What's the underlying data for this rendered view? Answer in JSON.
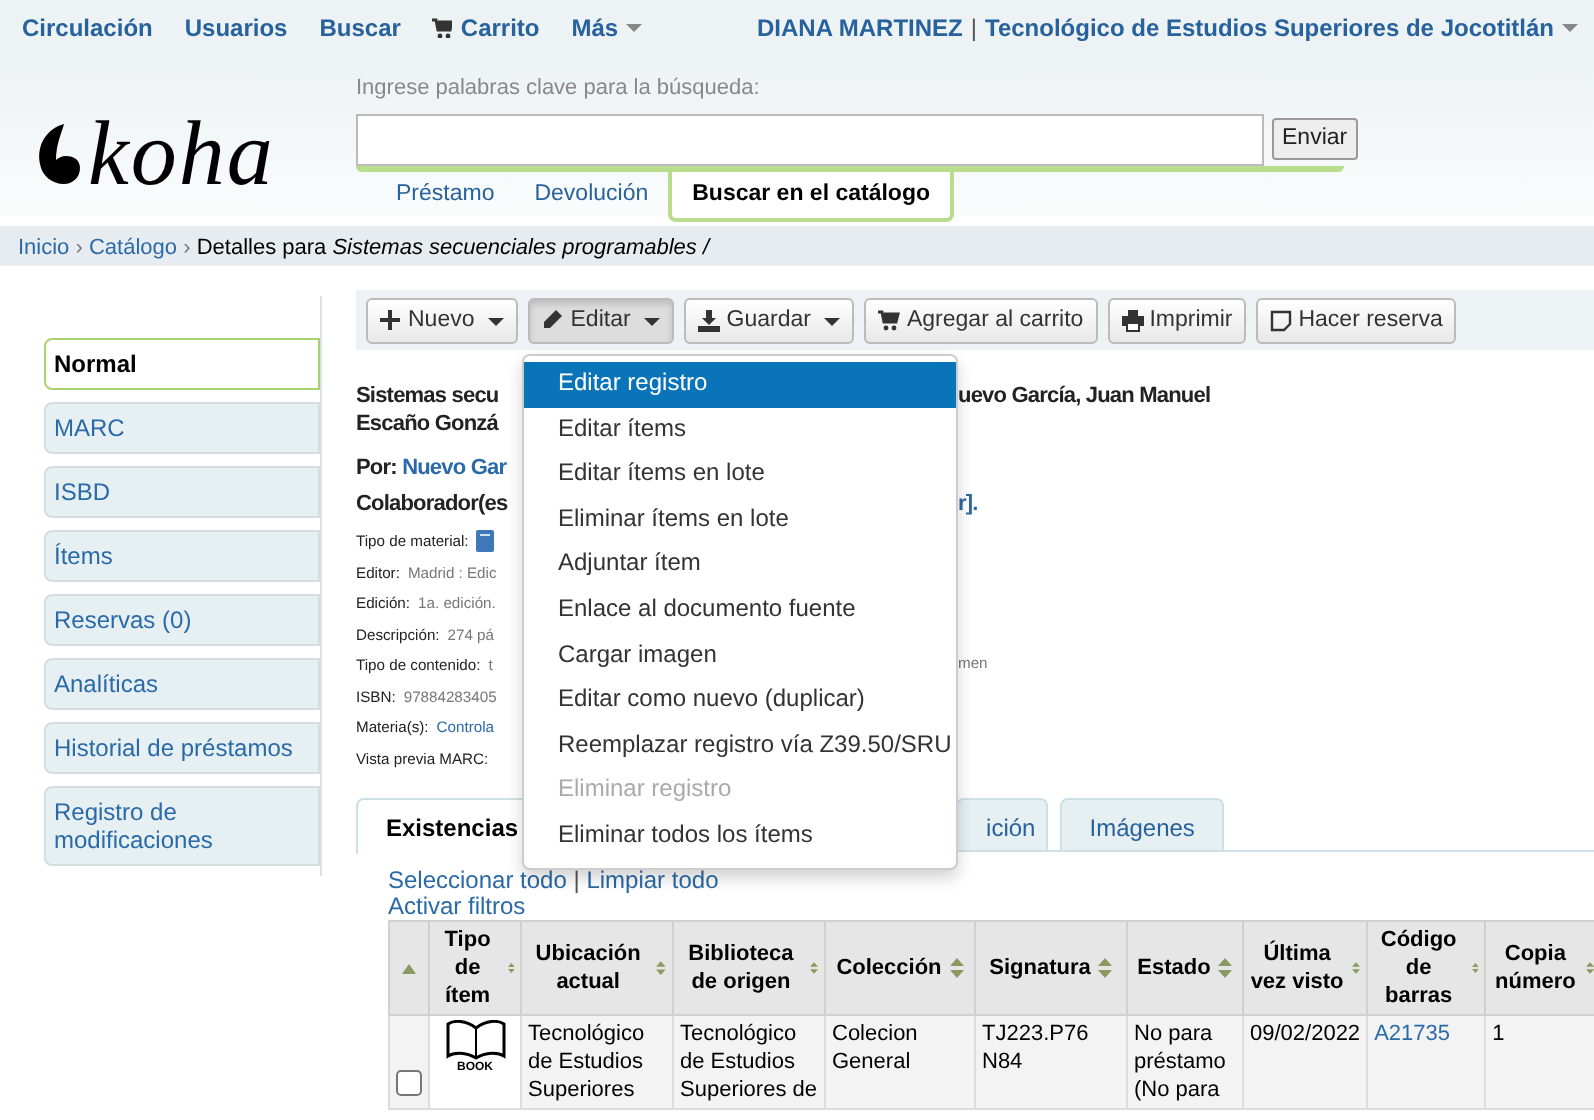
{
  "top_nav": {
    "links": [
      {
        "label": "Circulación",
        "kind": "link"
      },
      {
        "label": "Usuarios",
        "kind": "link"
      },
      {
        "label": "Buscar",
        "kind": "link"
      },
      {
        "label": "Carrito",
        "kind": "cart"
      },
      {
        "label": "Más",
        "kind": "menu"
      }
    ],
    "user": "DIANA MARTINEZ",
    "separator": "|",
    "library": "Tecnológico de Estudios Superiores de Jocotitlán"
  },
  "logo": {
    "text": "koha"
  },
  "search": {
    "label": "Ingrese palabras clave para la búsqueda:",
    "button": "Enviar",
    "tabs": [
      {
        "label": "Préstamo",
        "selected": false
      },
      {
        "label": "Devolución",
        "selected": false
      },
      {
        "label": "Buscar en el catálogo",
        "selected": true
      }
    ]
  },
  "breadcrumb": {
    "links": [
      "Inicio",
      "Catálogo"
    ],
    "separator": "›",
    "current": "Detalles para *Sistemas secuenciales programables /*"
  },
  "sidebar": [
    {
      "label": "Normal",
      "selected": true
    },
    {
      "label": "MARC",
      "selected": false
    },
    {
      "label": "ISBD",
      "selected": false
    },
    {
      "label": "Ítems",
      "selected": false
    },
    {
      "label": "Reservas (0)",
      "selected": false
    },
    {
      "label": "Analíticas",
      "selected": false
    },
    {
      "label": "Historial de préstamos",
      "selected": false
    },
    {
      "label": "Registro de modificaciones",
      "selected": false
    }
  ],
  "toolbar": [
    {
      "label": "Nuevo",
      "kind": "plus",
      "dropdown": true,
      "open": false
    },
    {
      "label": "Editar",
      "kind": "pencil",
      "dropdown": true,
      "open": true
    },
    {
      "label": "Guardar",
      "kind": "download",
      "dropdown": true,
      "open": false
    },
    {
      "label": "Agregar al carrito",
      "kind": "cart",
      "dropdown": false,
      "open": false
    },
    {
      "label": "Imprimir",
      "kind": "print",
      "dropdown": false,
      "open": false
    },
    {
      "label": "Hacer reserva",
      "kind": "note",
      "dropdown": false,
      "open": false
    }
  ],
  "menu": [
    {
      "label": "Editar registro",
      "selected": true,
      "disabled": false
    },
    {
      "label": "Editar ítems",
      "selected": false,
      "disabled": false
    },
    {
      "label": "Editar ítems en lote",
      "selected": false,
      "disabled": false
    },
    {
      "label": "Eliminar ítems en lote",
      "selected": false,
      "disabled": false
    },
    {
      "label": "Adjuntar ítem",
      "selected": false,
      "disabled": false
    },
    {
      "label": "Enlace al documento fuente",
      "selected": false,
      "disabled": false
    },
    {
      "label": "Cargar imagen",
      "selected": false,
      "disabled": false
    },
    {
      "label": "Editar como nuevo (duplicar)",
      "selected": false,
      "disabled": false
    },
    {
      "label": "Reemplazar registro vía Z39.50/SRU",
      "selected": false,
      "disabled": false
    },
    {
      "label": "Eliminar registro",
      "selected": false,
      "disabled": true
    },
    {
      "label": "Eliminar todos los ítems",
      "selected": false,
      "disabled": false
    }
  ],
  "record": {
    "title_left": [
      "Sistemas secu",
      "Escaño Gonzá"
    ],
    "title_right": "uevo García, Juan Manuel",
    "by_label": "Por:",
    "by_link": "Nuevo Gar",
    "contrib_left": "Colaborador(es",
    "contrib_right": "r].",
    "fields": [
      {
        "label": "Tipo de material:",
        "kind": "icon"
      },
      {
        "label": "Editor:",
        "value": "Madrid : Edic",
        "kind": "text"
      },
      {
        "label": "Edición:",
        "value": "1a. edición.",
        "kind": "text"
      },
      {
        "label": "Descripción:",
        "value": "274 pá",
        "kind": "text"
      },
      {
        "label": "Tipo de contenido:",
        "value": "t",
        "right": "men",
        "kind": "text"
      },
      {
        "label": "ISBN:",
        "value": "97884283405",
        "kind": "text"
      },
      {
        "label": "Materia(s):",
        "value": "Controla",
        "kind": "link"
      },
      {
        "label": "Vista previa MARC:",
        "kind": "none"
      }
    ]
  },
  "tabs": [
    {
      "label": "Existencias",
      "selected": true
    },
    {
      "label": "ición",
      "selected": false
    },
    {
      "label": "Imágenes",
      "selected": false
    }
  ],
  "select_links": [
    "Seleccionar todo",
    "Limpiar todo"
  ],
  "select_separator": "|",
  "filter_link": "Activar filtros",
  "table": {
    "columns": [
      {
        "kind": "sort-asc"
      },
      {
        "label": "Tipo de ítem",
        "kind": "sortable"
      },
      {
        "label": "Ubicación actual",
        "kind": "sortable"
      },
      {
        "label": "Biblioteca de origen",
        "kind": "sortable"
      },
      {
        "label": "Colección",
        "kind": "sortable"
      },
      {
        "label": "Signatura",
        "kind": "sortable"
      },
      {
        "label": "Estado",
        "kind": "sortable"
      },
      {
        "label": "Última vez visto",
        "kind": "sortable"
      },
      {
        "label": "Código de barras",
        "kind": "sortable"
      },
      {
        "label": "Copia número",
        "kind": "sortable"
      }
    ],
    "rows": [
      {
        "checked": false,
        "cells": [
          "",
          "BOOK",
          "Tecnológico de Estudios Superiores",
          "Tecnológico de Estudios Superiores de",
          "Colecion General",
          "TJ223.P76 N84",
          "No para préstamo (No para",
          "09/02/2022",
          "A21735",
          "1"
        ]
      }
    ]
  }
}
